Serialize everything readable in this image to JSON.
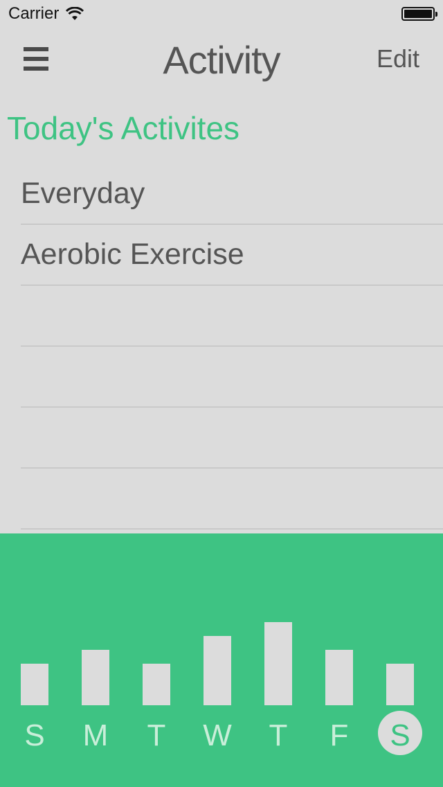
{
  "status": {
    "carrier": "Carrier",
    "icons": [
      "wifi-icon",
      "battery-icon"
    ]
  },
  "nav": {
    "title": "Activity",
    "edit_label": "Edit",
    "menu_icon": "hamburger-menu-icon"
  },
  "section": {
    "title": "Today's Activites"
  },
  "list": {
    "rows": [
      {
        "label": "Everyday"
      },
      {
        "label": "Aerobic Exercise"
      },
      {
        "label": ""
      },
      {
        "label": ""
      },
      {
        "label": ""
      },
      {
        "label": ""
      }
    ]
  },
  "colors": {
    "accent": "#3ec383",
    "background": "#dcdcdc",
    "bar": "#dcdcdc",
    "day_label": "#c9eed9",
    "selected_day_label": "#3ec383"
  },
  "chart_data": {
    "type": "bar",
    "categories": [
      "S",
      "M",
      "T",
      "W",
      "T",
      "F",
      "S"
    ],
    "values": [
      3,
      4,
      3,
      5,
      6,
      4,
      3
    ],
    "ylim": [
      0,
      6
    ],
    "selected_index": 6,
    "grid": false,
    "title": "",
    "xlabel": "",
    "ylabel": ""
  }
}
